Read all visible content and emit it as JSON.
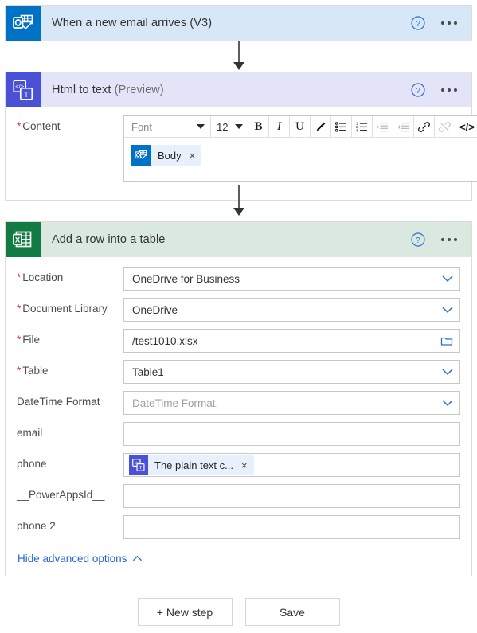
{
  "colors": {
    "outlook_header_bg": "#d7e7f7",
    "outlook_icon_bg": "#0072c6",
    "html_header_bg": "#e4e4f8",
    "html_icon_bg": "#4a51d6",
    "excel_header_bg": "#dbe8df",
    "excel_icon_bg": "#117b43",
    "required_asterisk": "#cf3b2f",
    "link_blue": "#2266dd",
    "token_chip_bg": "#e8f0fb"
  },
  "steps": [
    {
      "id": "trigger",
      "title": "When a new email arrives (V3)",
      "title_suffix": "",
      "icon": "outlook-icon",
      "help_icon": "help-circle-icon",
      "menu_icon": "more-options-icon"
    },
    {
      "id": "html_to_text",
      "title": "Html to text ",
      "title_suffix": "(Preview)",
      "icon": "html-to-text-icon",
      "help_icon": "help-circle-icon",
      "menu_icon": "more-options-icon",
      "content_field": {
        "label": "Content",
        "required": true,
        "toolbar": {
          "font_value": "Font",
          "size_value": "12",
          "bold": "B",
          "italic": "I",
          "underline": "U",
          "pen": "pen-icon",
          "bulleted_list": "bulleted-list-icon",
          "numbered_list": "numbered-list-icon",
          "indent": "indent-icon",
          "outdent": "outdent-icon",
          "link": "link-icon",
          "unlink": "unlink-icon",
          "code_view": "</>"
        },
        "token": {
          "label": "Body",
          "icon": "outlook-icon",
          "remove": "×"
        }
      }
    },
    {
      "id": "add_row",
      "title": "Add a row into a table",
      "title_suffix": "",
      "icon": "excel-icon",
      "help_icon": "help-circle-icon",
      "menu_icon": "more-options-icon",
      "fields": [
        {
          "label": "Location",
          "required": true,
          "type": "dropdown",
          "value": "OneDrive for Business",
          "placeholder": ""
        },
        {
          "label": "Document Library",
          "required": true,
          "type": "dropdown",
          "value": "OneDrive",
          "placeholder": ""
        },
        {
          "label": "File",
          "required": true,
          "type": "filepicker",
          "value": "/test1010.xlsx",
          "placeholder": ""
        },
        {
          "label": "Table",
          "required": true,
          "type": "dropdown",
          "value": "Table1",
          "placeholder": ""
        },
        {
          "label": "DateTime Format",
          "required": false,
          "type": "dropdown",
          "value": "",
          "placeholder": "DateTime Format."
        },
        {
          "label": "email",
          "required": false,
          "type": "text",
          "value": "",
          "placeholder": ""
        },
        {
          "label": "phone",
          "required": false,
          "type": "token",
          "value": "",
          "placeholder": "",
          "token": {
            "label": "The plain text c...",
            "icon": "html-to-text-icon",
            "remove": "×"
          }
        },
        {
          "label": "__PowerAppsId__",
          "required": false,
          "type": "text",
          "value": "",
          "placeholder": ""
        },
        {
          "label": "phone 2",
          "required": false,
          "type": "text",
          "value": "",
          "placeholder": ""
        }
      ],
      "advanced_toggle": {
        "label": "Hide advanced options",
        "icon": "chevron-up-icon"
      }
    }
  ],
  "footer": {
    "new_step_label": "+ New step",
    "save_label": "Save"
  }
}
